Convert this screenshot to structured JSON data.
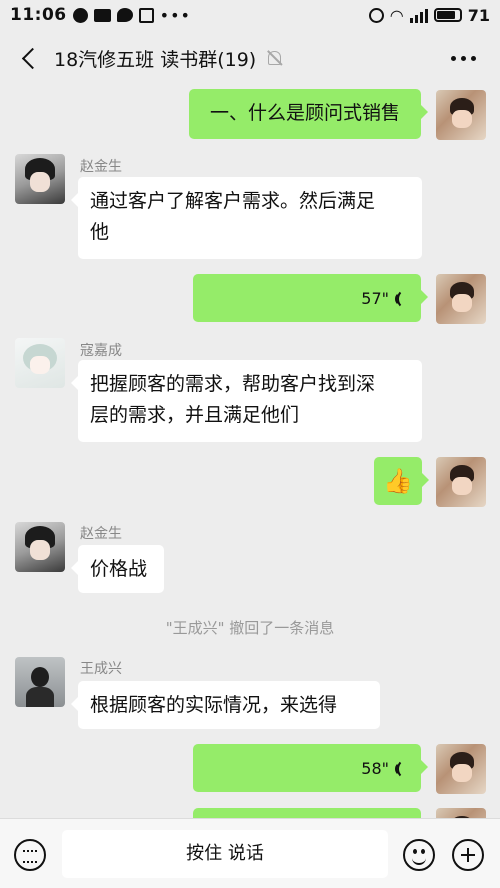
{
  "status_bar": {
    "time": "11:06",
    "battery": "71",
    "network": "4G"
  },
  "header": {
    "title": "18汽修五班  读书群(19)",
    "back_icon": "back-arrow-icon",
    "mute_icon": "bell-muted-icon",
    "more_icon": "more-dots-icon"
  },
  "messages": [
    {
      "type": "text",
      "side": "right",
      "text": "一、什么是顾问式销售"
    },
    {
      "type": "text",
      "side": "left",
      "sender": "赵金生",
      "text_line1": "通过客户了解客户需求。然后满足",
      "text_line2": "他"
    },
    {
      "type": "voice",
      "side": "right",
      "duration": "57\""
    },
    {
      "type": "text",
      "side": "left",
      "sender": "寇嘉成",
      "text_line1": "把握顾客的需求，帮助客户找到深",
      "text_line2": "层的需求，并且满足他们"
    },
    {
      "type": "emoji",
      "side": "right",
      "emoji": "👍"
    },
    {
      "type": "text",
      "side": "left",
      "sender": "赵金生",
      "text": "价格战"
    },
    {
      "type": "system",
      "text": "\"王成兴\" 撤回了一条消息"
    },
    {
      "type": "text",
      "side": "left",
      "sender": "王成兴",
      "text": "根据顾客的实际情况，来选得"
    },
    {
      "type": "voice",
      "side": "right",
      "duration": "58\""
    }
  ],
  "footer": {
    "talk_label": "按住 说话",
    "keyboard_icon": "keyboard-icon",
    "emoji_icon": "emoji-icon",
    "plus_icon": "plus-icon"
  },
  "colors": {
    "background": "#ededed",
    "self_bubble": "#95ec69",
    "other_bubble": "#ffffff"
  }
}
